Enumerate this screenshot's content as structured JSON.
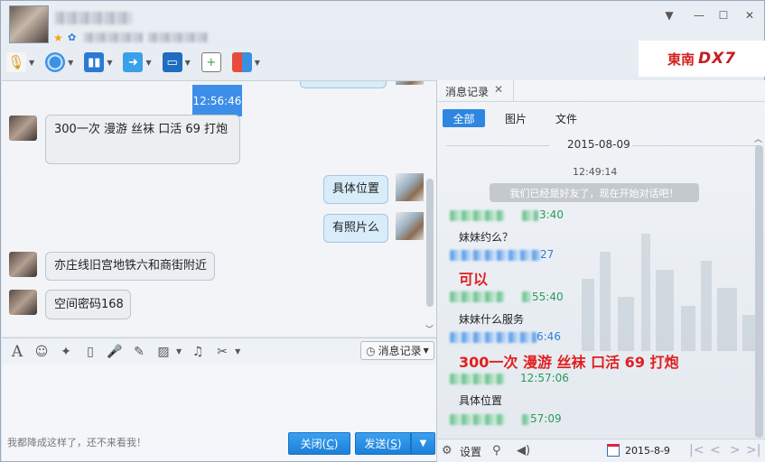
{
  "window": {
    "controls": {
      "menu": "▼",
      "minimize": "—",
      "maximize": "☐",
      "close": "✕"
    }
  },
  "toolbar": {
    "icons": [
      "microphone-icon",
      "video-call-icon",
      "share-screen-icon",
      "send-file-icon",
      "remote-desktop-icon",
      "invite-icon",
      "apps-icon"
    ]
  },
  "ad": {
    "brand": "東南",
    "model": "DX7"
  },
  "chat": {
    "highlight_time": "12:56:46",
    "messages": [
      {
        "side": "them",
        "text": "300一次  漫游 丝袜 口活 69 打炮"
      },
      {
        "side": "me",
        "text": "具体位置"
      },
      {
        "side": "me",
        "text": "有照片么"
      },
      {
        "side": "them",
        "text": "亦庄线旧宫地铁六和商街附近"
      },
      {
        "side": "them",
        "text": "空间密码168"
      }
    ]
  },
  "input": {
    "history_label": "消息记录",
    "hint": "我都降成这样了，还不来看我！",
    "close_label": "关闭",
    "close_key": "C",
    "send_label": "发送",
    "send_key": "S"
  },
  "history_panel": {
    "tab_title": "消息记录",
    "filters": [
      "全部",
      "图片",
      "文件"
    ],
    "date": "2015-08-09",
    "first_time": "12:49:14",
    "system_note": "我们已经是好友了，现在开始对话吧！",
    "entries": [
      {
        "meta": "3:40",
        "meta_color": "green",
        "text": "妹妹约么？"
      },
      {
        "meta": "27",
        "meta_color": "blue",
        "text": "可以",
        "big": true
      },
      {
        "meta": "55:40",
        "meta_color": "green",
        "text": "妹妹什么服务"
      },
      {
        "meta": "6:46",
        "meta_color": "blue",
        "text": "300一次  漫游 丝袜 口活 69 打炮",
        "big": true
      },
      {
        "meta": "12:57:06",
        "meta_color": "green",
        "text": "具体位置"
      },
      {
        "meta": "57:09",
        "meta_color": "green",
        "text": ""
      }
    ],
    "bottom": {
      "settings_label": "设置",
      "date": "2015-8-9"
    }
  }
}
